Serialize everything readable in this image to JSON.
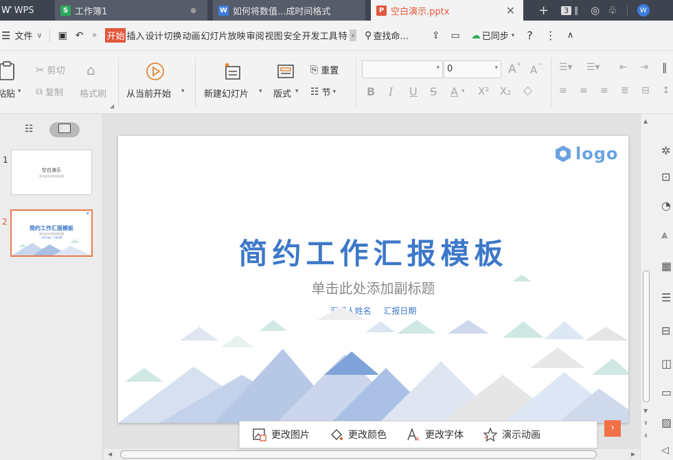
{
  "tabs": {
    "wps_label": "WPS",
    "workbook_label": "工作簿1",
    "doc_label": "如何将数值...成时间格式",
    "ppt_label": "空白演示.pptx",
    "count_badge": "3"
  },
  "menu": {
    "file_label": "文件",
    "items": [
      "开始",
      "插入",
      "设计",
      "切换",
      "动画",
      "幻灯片放映",
      "审阅",
      "视图",
      "安全",
      "开发工具",
      "特"
    ],
    "search_label": "查找命...",
    "sync_label": "已同步",
    "help": "?",
    "more": "⋮"
  },
  "ribbon": {
    "paste": "粘贴",
    "cut": "剪切",
    "copy": "复制",
    "format_painter": "格式刷",
    "play_from_current": "从当前开始",
    "new_slide": "新建幻灯片",
    "layout": "版式",
    "reset": "重置",
    "section": "节",
    "font_size": "0",
    "bold": "B",
    "italic": "I",
    "underline": "U",
    "strike": "S",
    "font_color": "A",
    "grow_font": "A",
    "shrink_font": "A",
    "superscript": "X²",
    "subscript": "X₂"
  },
  "slides_panel": {
    "slide1_number": "1",
    "slide1_title": "空白演示",
    "slide1_subtitle": "单击此处添加副标题",
    "slide2_number": "2",
    "slide2_title": "简约工作汇报模板",
    "slide2_subtitle": "单击此处添加副标题",
    "slide2_meta": "汇报人姓名　汇报日期"
  },
  "slide": {
    "logo_text": "logo",
    "title": "简约工作汇报模板",
    "subtitle": "单击此处添加副标题",
    "reporter": "汇报人姓名",
    "date": "汇报日期"
  },
  "floatbar": {
    "change_image": "更改图片",
    "change_color": "更改颜色",
    "change_font": "更改字体",
    "animation": "演示动画",
    "expand": "›"
  },
  "colors": {
    "accent": "#e0573a",
    "slide_blue": "#3d78c9",
    "tab_bg": "#3e4350"
  }
}
